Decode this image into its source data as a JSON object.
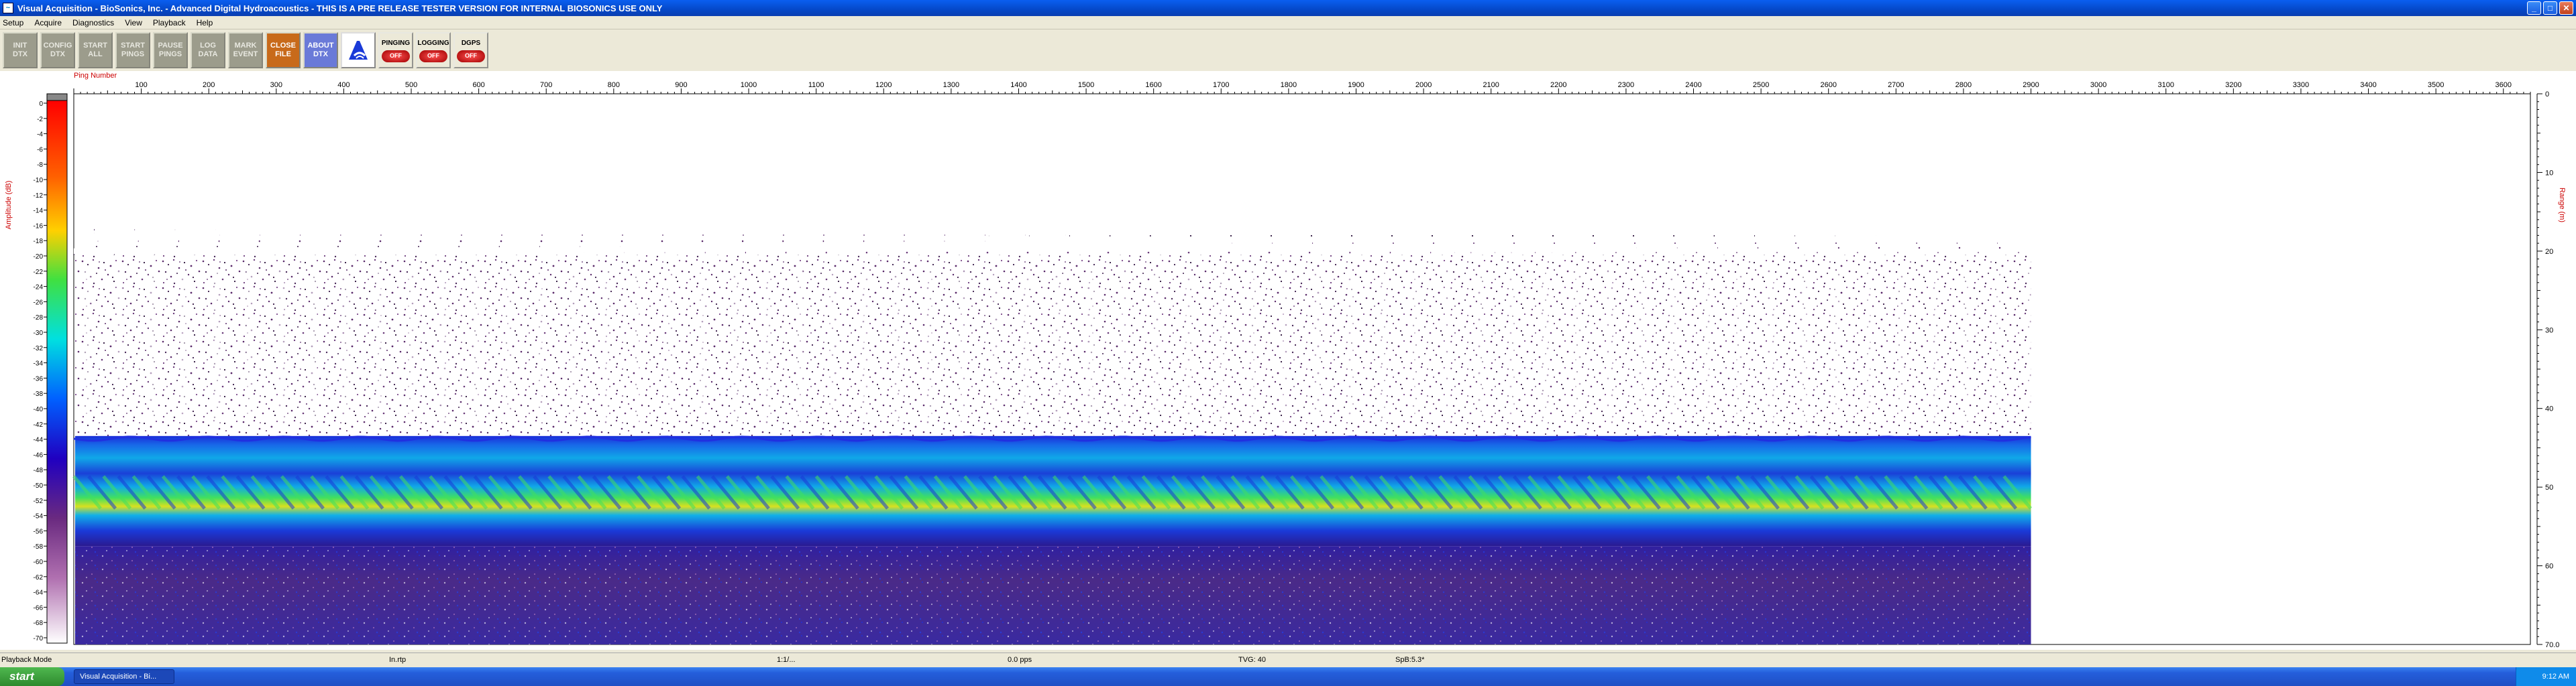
{
  "window": {
    "title": "Visual Acquisition  -  BioSonics, Inc.  -  Advanced Digital Hydroacoustics  -  THIS IS A PRE RELEASE TESTER VERSION FOR INTERNAL BIOSONICS USE ONLY"
  },
  "menu": [
    "Setup",
    "Acquire",
    "Diagnostics",
    "View",
    "Playback",
    "Help"
  ],
  "toolbar": {
    "buttons": [
      {
        "label": "INIT\nDTX",
        "style": "gray"
      },
      {
        "label": "CONFIG\nDTX",
        "style": "gray"
      },
      {
        "label": "START\nALL",
        "style": "gray"
      },
      {
        "label": "START\nPINGS",
        "style": "gray"
      },
      {
        "label": "PAUSE\nPINGS",
        "style": "gray"
      },
      {
        "label": "LOG\nDATA",
        "style": "gray"
      },
      {
        "label": "MARK\nEVENT",
        "style": "gray"
      },
      {
        "label": "CLOSE\nFILE",
        "style": "orange"
      },
      {
        "label": "ABOUT\nDTX",
        "style": "blue"
      }
    ],
    "toggles": [
      {
        "label": "PINGING",
        "state": "OFF"
      },
      {
        "label": "LOGGING",
        "state": "OFF"
      },
      {
        "label": "DGPS",
        "state": "OFF"
      }
    ]
  },
  "echogram": {
    "x_axis_label": "Ping Number",
    "x_ticks": [
      100,
      200,
      300,
      400,
      500,
      600,
      700,
      800,
      900,
      1000,
      1100,
      1200,
      1300,
      1400,
      1500,
      1600,
      1700,
      1800,
      1900,
      2000,
      2100,
      2200,
      2300,
      2400,
      2500,
      2600,
      2700,
      2800,
      2900,
      3000,
      3100,
      3200,
      3300,
      3400,
      3500,
      3600
    ],
    "x_range": [
      0,
      3640
    ],
    "data_end_ping": 2900,
    "scale_label": "Amplitude (dB)",
    "scale_ticks": [
      "0",
      "-2",
      "-4",
      "-6",
      "-8",
      "-10",
      "-12",
      "-14",
      "-16",
      "-18",
      "-20",
      "-22",
      "-24",
      "-26",
      "-28",
      "-30",
      "-32",
      "-34",
      "-36",
      "-38",
      "-40",
      "-42",
      "-44",
      "-46",
      "-48",
      "-50",
      "-52",
      "-54",
      "-56",
      "-58",
      "-60",
      "-62",
      "-64",
      "-66",
      "-68",
      "-70"
    ],
    "depth_label": "Range (m)",
    "depth_ticks": [
      "0",
      "10",
      "20",
      "30",
      "40",
      "50",
      "60",
      "70.0"
    ],
    "depth_range": [
      0,
      70
    ],
    "bottom_depth_m": 43.5,
    "band_depth_m": 50.5,
    "noise_top_m": 20.5,
    "colors": {
      "noise": "#5a2a6a",
      "band_outer": "#1a2ed8",
      "band_mid": "#10a8e8",
      "band_core": "#40e060",
      "hot": "#e8e020",
      "axis_label": "#cc0000"
    }
  },
  "status": {
    "mode": "Playback Mode",
    "file": "In.rtp",
    "ratio": "1:1/...",
    "rate": "0.0 pps",
    "tvg": "TVG: 40",
    "spb": "SpB:5.3*"
  },
  "taskbar": {
    "start_label": "start",
    "tasks": [
      "Visual Acquisition  -  Bi...",
      "Visual Acquisition  -  Bi..."
    ],
    "clock": "9:12 AM"
  }
}
